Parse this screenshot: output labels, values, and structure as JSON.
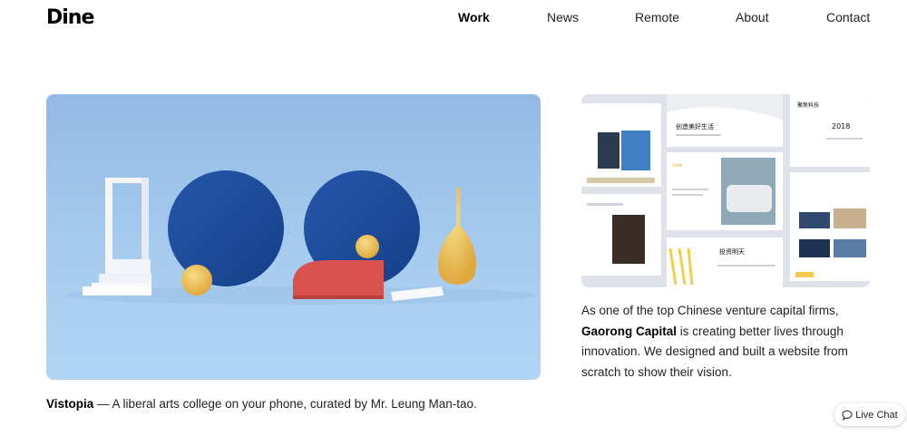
{
  "brand": {
    "logo": "Dine"
  },
  "nav": {
    "items": [
      {
        "label": "Work",
        "active": true
      },
      {
        "label": "News",
        "active": false
      },
      {
        "label": "Remote",
        "active": false
      },
      {
        "label": "About",
        "active": false
      },
      {
        "label": "Contact",
        "active": false
      }
    ]
  },
  "projects": [
    {
      "name": "Vistopia",
      "separator": " — ",
      "description": "A liberal arts college on your phone, curated by Mr. Leung Man-tao."
    },
    {
      "intro": "As one of the top Chinese venture capital firms, ",
      "name": "Gaorong Capital",
      "description": " is creating better lives through innovation. We designed and built a website from scratch to show their vision."
    }
  ],
  "collage_text": {
    "year": "2018",
    "headline_1": "创造美好生活",
    "headline_2": "投资明天",
    "headline_3": "聚焦科技",
    "label": "YUAN"
  },
  "live_chat": {
    "label": "Live Chat",
    "icon": "chat-bubble-icon"
  },
  "colors": {
    "hero_bg": "#9fc4ea",
    "circle_blue": "#1d4e9e",
    "sphere_yellow": "#efc65d",
    "red_shape": "#d95550"
  }
}
